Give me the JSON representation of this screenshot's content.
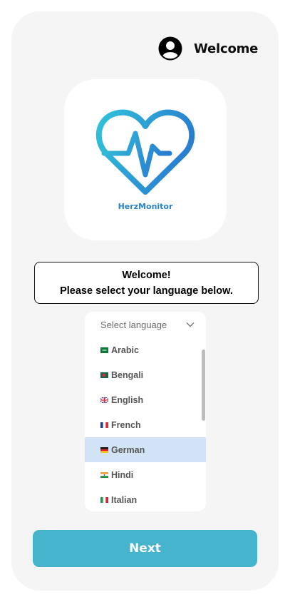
{
  "header": {
    "title": "Welcome",
    "avatar_icon": "user-circle-icon"
  },
  "logo": {
    "brand_name": "HerzMonitor",
    "icon": "heart-pulse-icon",
    "gradient": [
      "#31c2d9",
      "#2a7ed0"
    ]
  },
  "message": {
    "line1": "Welcome!",
    "line2": "Please select your language below."
  },
  "language_select": {
    "placeholder": "Select language",
    "selected": "German",
    "options": [
      {
        "label": "Arabic",
        "flag": "flag-sa-icon"
      },
      {
        "label": "Bengali",
        "flag": "flag-bd-icon"
      },
      {
        "label": "English",
        "flag": "flag-gb-icon"
      },
      {
        "label": "French",
        "flag": "flag-fr-icon"
      },
      {
        "label": "German",
        "flag": "flag-de-icon"
      },
      {
        "label": "Hindi",
        "flag": "flag-in-icon"
      },
      {
        "label": "Italian",
        "flag": "flag-it-icon"
      }
    ]
  },
  "next_button": {
    "label": "Next"
  },
  "colors": {
    "primary": "#46b4cc",
    "selected_row": "#d3e3f6",
    "brand_text": "#2b84c6"
  }
}
